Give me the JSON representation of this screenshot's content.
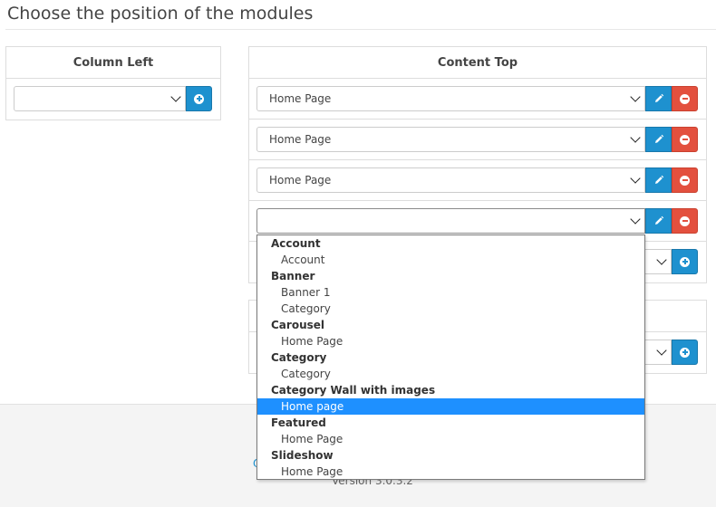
{
  "page": {
    "title": "Choose the position of the modules"
  },
  "column_left": {
    "heading": "Column Left",
    "select_value": ""
  },
  "content_top": {
    "heading": "Content Top",
    "rows": [
      {
        "value": "Home Page"
      },
      {
        "value": "Home Page"
      },
      {
        "value": "Home Page"
      },
      {
        "value": ""
      }
    ],
    "add_row_value": ""
  },
  "second_panel": {
    "add_row_value": ""
  },
  "dropdown": {
    "groups": [
      {
        "label": "Account",
        "options": [
          "Account"
        ]
      },
      {
        "label": "Banner",
        "options": [
          "Banner 1",
          "Category"
        ]
      },
      {
        "label": "Carousel",
        "options": [
          "Home Page"
        ]
      },
      {
        "label": "Category",
        "options": [
          "Category"
        ]
      },
      {
        "label": "Category Wall with images",
        "options": [
          "Home page"
        ]
      },
      {
        "label": "Featured",
        "options": [
          "Home Page"
        ]
      },
      {
        "label": "Slideshow",
        "options": [
          "Home Page"
        ]
      }
    ],
    "highlighted": "Home page"
  },
  "footer": {
    "link_char": "O",
    "version": "Version 3.0.3.2"
  },
  "colors": {
    "primary": "#1e91cf",
    "danger": "#e3503e",
    "highlight": "#1e90ff"
  }
}
